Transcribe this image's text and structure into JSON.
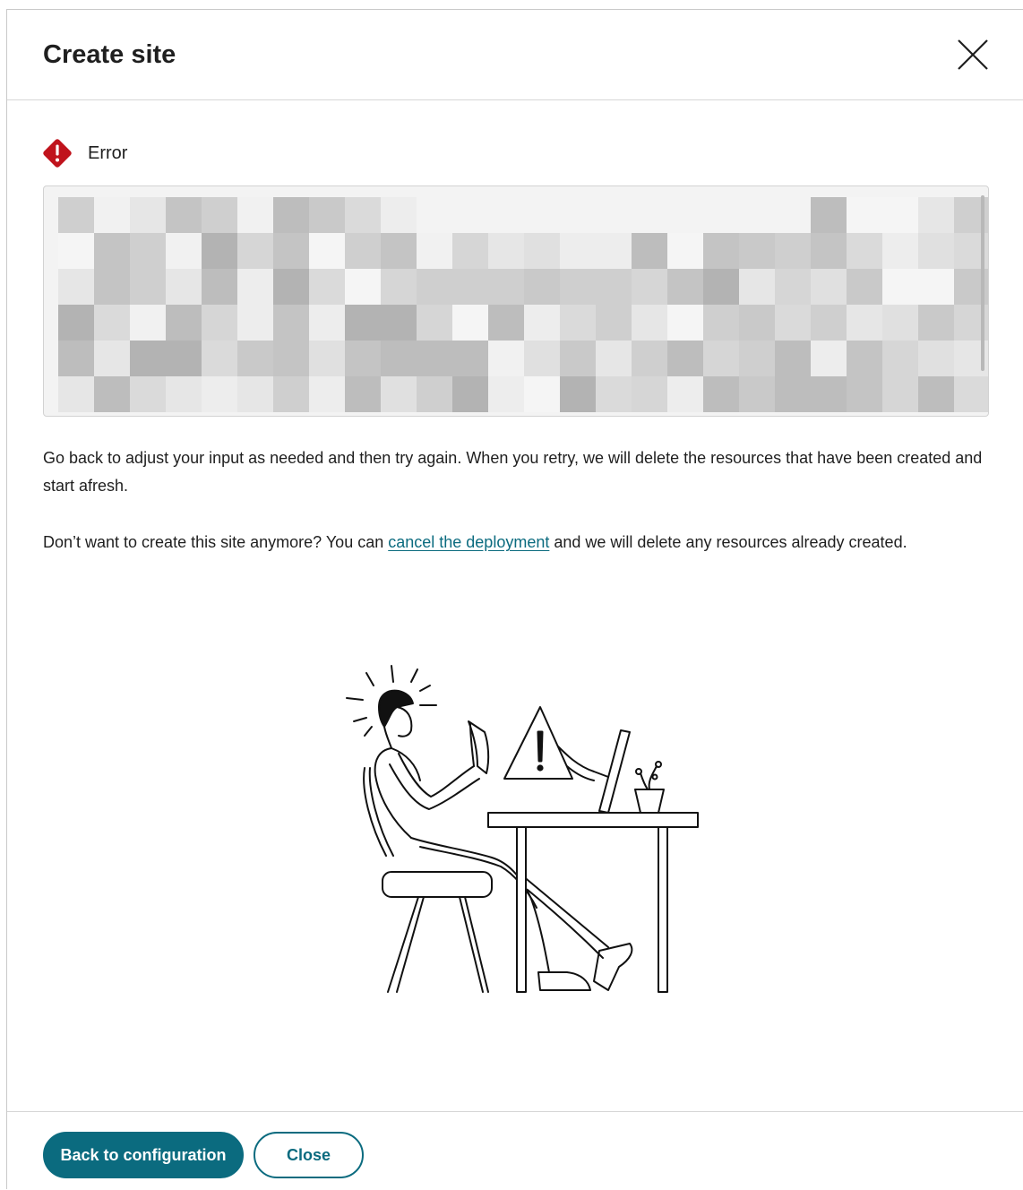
{
  "dialog": {
    "title": "Create site"
  },
  "error": {
    "label": "Error",
    "details_content": "",
    "accent_color": "#c0131c"
  },
  "body": {
    "paragraph_1": "Go back to adjust your input as needed and then try again. When you retry, we will delete the resources that have been created and start afresh.",
    "paragraph_2_before": "Don’t want to create this site anymore? You can ",
    "paragraph_2_link": "cancel the deployment",
    "paragraph_2_after": " and we will delete any resources already created."
  },
  "footer": {
    "primary_label": "Back to configuration",
    "secondary_label": "Close"
  },
  "colors": {
    "brand": "#0b6b7f",
    "error": "#c0131c"
  },
  "icons": {
    "close": "close-x-icon",
    "error": "error-diamond-icon"
  }
}
